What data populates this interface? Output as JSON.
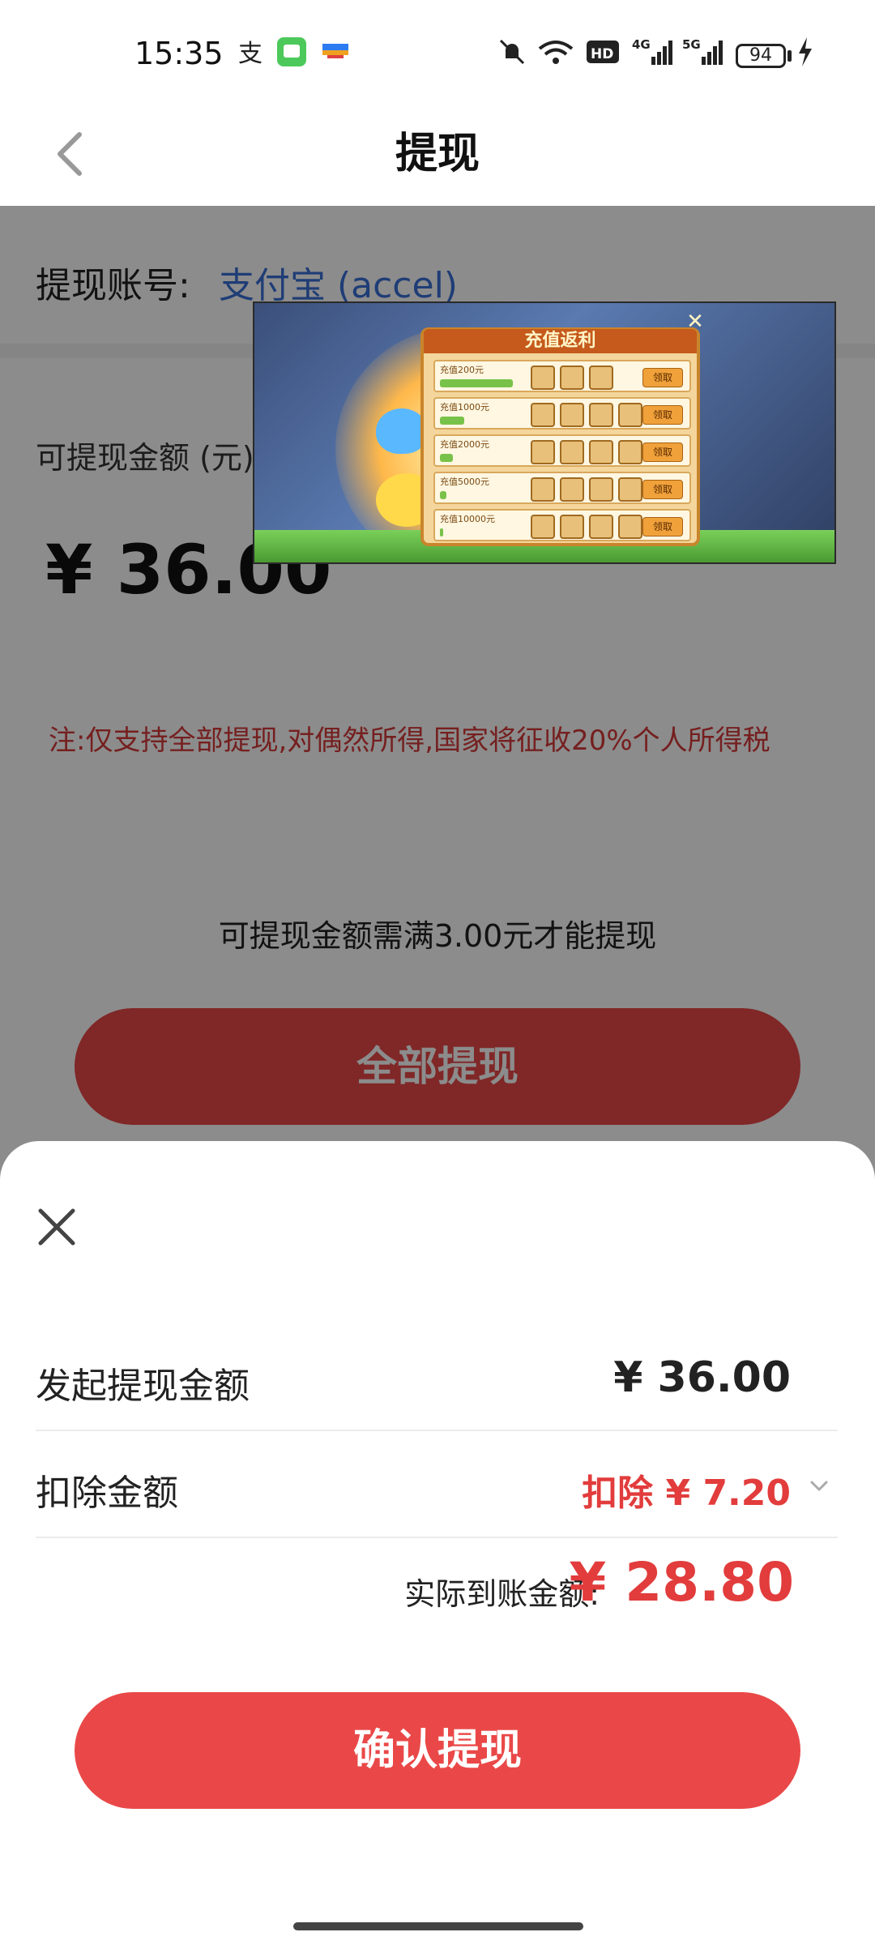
{
  "status_bar": {
    "time": "15:35",
    "battery_level": "94",
    "icons": [
      "alipay-icon",
      "messages-icon",
      "app-icon",
      "mute-icon",
      "wifi-icon",
      "hd-icon",
      "signal-4g-icon",
      "signal-5g-icon",
      "charging-icon"
    ]
  },
  "header": {
    "title": "提现",
    "back_icon": "chevron-left-icon"
  },
  "account": {
    "label": "提现账号:",
    "value": "支付宝 (accel)"
  },
  "balance": {
    "label": "可提现金额 (元)",
    "amount": "¥ 36.00"
  },
  "note": "注:仅支持全部提现,对偶然所得,国家将征收20%个人所得税",
  "minimum_note": "可提现金额需满3.00元才能提现",
  "withdraw_all_label": "全部提现",
  "ad": {
    "title": "充值返利",
    "rows": [
      {
        "label": "充值200元",
        "progress": "200/200",
        "claim": "领取"
      },
      {
        "label": "充值1000元",
        "progress": "300/1000",
        "claim": "领取"
      },
      {
        "label": "充值2000元",
        "progress": "300/2000",
        "claim": "领取"
      },
      {
        "label": "充值5000元",
        "progress": "300/5000",
        "claim": "领取"
      },
      {
        "label": "充值10000元",
        "progress": "300/10000",
        "claim": "领取"
      }
    ]
  },
  "sheet": {
    "close_icon": "close-icon",
    "initiate_label": "发起提现金额",
    "initiate_value": "¥ 36.00",
    "deduct_label": "扣除金额",
    "deduct_value": "扣除 ¥ 7.20",
    "actual_label": "实际到账金额:",
    "actual_value": "¥ 28.80",
    "confirm_label": "确认提现"
  },
  "colors": {
    "accent_red": "#ea4848",
    "link_blue": "#3a6fd8",
    "note_red": "#d63a3a"
  }
}
